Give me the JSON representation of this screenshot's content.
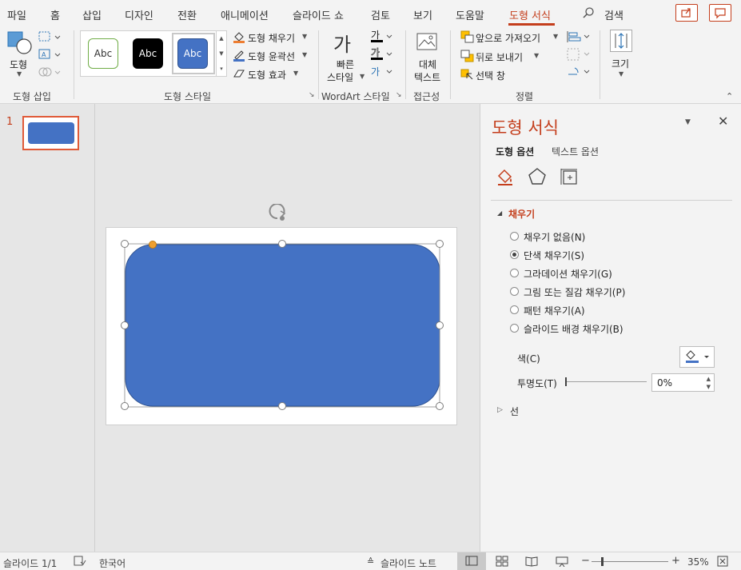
{
  "tabs": [
    {
      "label": "파일"
    },
    {
      "label": "홈"
    },
    {
      "label": "삽입"
    },
    {
      "label": "디자인"
    },
    {
      "label": "전환"
    },
    {
      "label": "애니메이션"
    },
    {
      "label": "슬라이드 쇼"
    },
    {
      "label": "검토"
    },
    {
      "label": "보기"
    },
    {
      "label": "도움말"
    },
    {
      "label": "도형 서식"
    }
  ],
  "search_label": "검색",
  "ribbon": {
    "insert_shapes": {
      "shape_label": "도형",
      "group_label": "도형 삽입"
    },
    "shape_styles": {
      "samples": [
        "Abc",
        "Abc",
        "Abc"
      ],
      "fill_label": "도형 채우기",
      "outline_label": "도형 윤곽선",
      "effects_label": "도형 효과",
      "group_label": "도형 스타일"
    },
    "wordart": {
      "quick_styles_line1": "빠른",
      "quick_styles_line2": "스타일",
      "glyph": "가",
      "group_label": "WordArt 스타일"
    },
    "accessibility": {
      "alt_text_line1": "대체",
      "alt_text_line2": "텍스트",
      "group_label": "접근성"
    },
    "arrange": {
      "bring_forward": "앞으로 가져오기",
      "send_backward": "뒤로 보내기",
      "selection_pane": "선택 창",
      "group_label": "정렬"
    },
    "size": {
      "label": "크기"
    }
  },
  "thumbnails": {
    "slide_number": "1"
  },
  "format_pane": {
    "title": "도형 서식",
    "tab_shape_options": "도형 옵션",
    "tab_text_options": "텍스트 옵션",
    "fill_section": "채우기",
    "fill_options": [
      {
        "label": "채우기 없음(N)",
        "selected": false
      },
      {
        "label": "단색 채우기(S)",
        "selected": true
      },
      {
        "label": "그라데이션 채우기(G)",
        "selected": false
      },
      {
        "label": "그림 또는 질감 채우기(P)",
        "selected": false
      },
      {
        "label": "패턴 채우기(A)",
        "selected": false
      },
      {
        "label": "슬라이드 배경 채우기(B)",
        "selected": false
      }
    ],
    "color_label": "색(C)",
    "transparency_label": "투명도(T)",
    "transparency_value": "0%",
    "line_section": "선"
  },
  "status": {
    "slide_info": "슬라이드 1/1",
    "language": "한국어",
    "notes": "슬라이드 노트",
    "zoom": "35%"
  },
  "colors": {
    "accent": "#c43e1c",
    "shape_fill": "#4472c4",
    "handle_yellow": "#f0a030"
  }
}
